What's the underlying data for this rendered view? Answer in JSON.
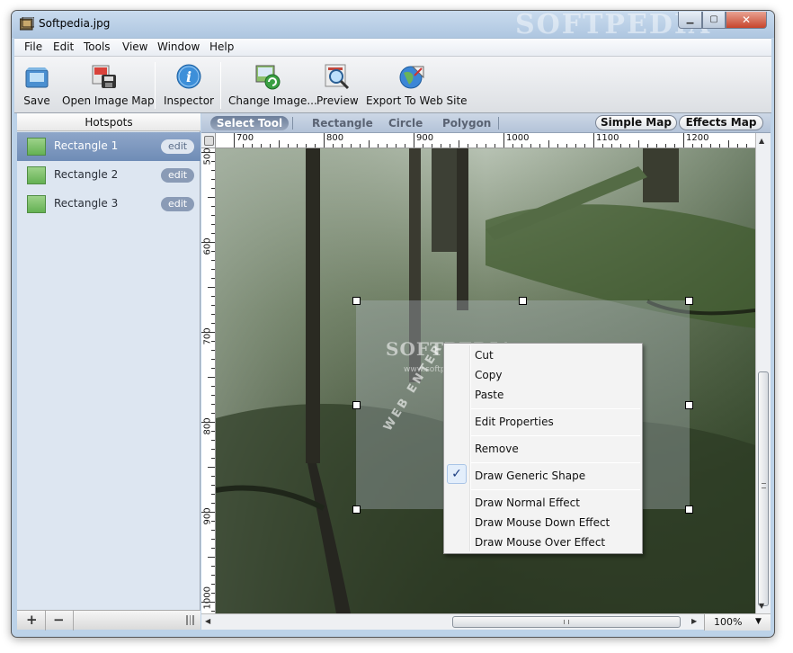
{
  "window": {
    "title": "Softpedia.jpg",
    "watermark": "SOFTPEDIA",
    "controls": {
      "minimize": "▁",
      "maximize": "▢",
      "close": "✕"
    }
  },
  "menubar": [
    "File",
    "Edit",
    "Tools",
    "View",
    "Window",
    "Help"
  ],
  "toolbar": {
    "save": "Save",
    "open_image_map": "Open Image Map",
    "inspector": "Inspector",
    "change_image": "Change Image...",
    "preview": "Preview",
    "export": "Export To Web Site"
  },
  "hotspots": {
    "header": "Hotspots",
    "items": [
      {
        "name": "Rectangle 1",
        "edit": "edit",
        "selected": true
      },
      {
        "name": "Rectangle 2",
        "edit": "edit",
        "selected": false
      },
      {
        "name": "Rectangle 3",
        "edit": "edit",
        "selected": false
      }
    ],
    "add": "+",
    "remove": "−"
  },
  "modes": {
    "select_tool": "Select Tool",
    "rectangle": "Rectangle",
    "circle": "Circle",
    "polygon": "Polygon",
    "simple_map": "Simple Map",
    "effects_map": "Effects Map"
  },
  "ruler": {
    "horizontal": [
      "700",
      "800",
      "900",
      "1000",
      "1100",
      "1200"
    ],
    "vertical": [
      "500",
      "600",
      "700",
      "800",
      "900",
      "1000"
    ]
  },
  "canvas": {
    "watermark_text": "SOFTPEDIA",
    "watermark_url": "www.softpedia.com",
    "watermark_arc": "WEB ENTER"
  },
  "context_menu": {
    "items": [
      "Cut",
      "Copy",
      "Paste",
      "Edit Properties",
      "Remove",
      "Draw Generic Shape",
      "Draw Normal Effect",
      "Draw Mouse Down Effect",
      "Draw Mouse Over Effect"
    ],
    "checked": "Draw Generic Shape",
    "check_mark": "✓"
  },
  "zoom": {
    "value": "100%",
    "arrow": "▼"
  },
  "colors": {
    "selected_row": "#7e98bf",
    "hotspot_swatch": "#7cc066",
    "canvas_dark": "#2f3a2a"
  }
}
